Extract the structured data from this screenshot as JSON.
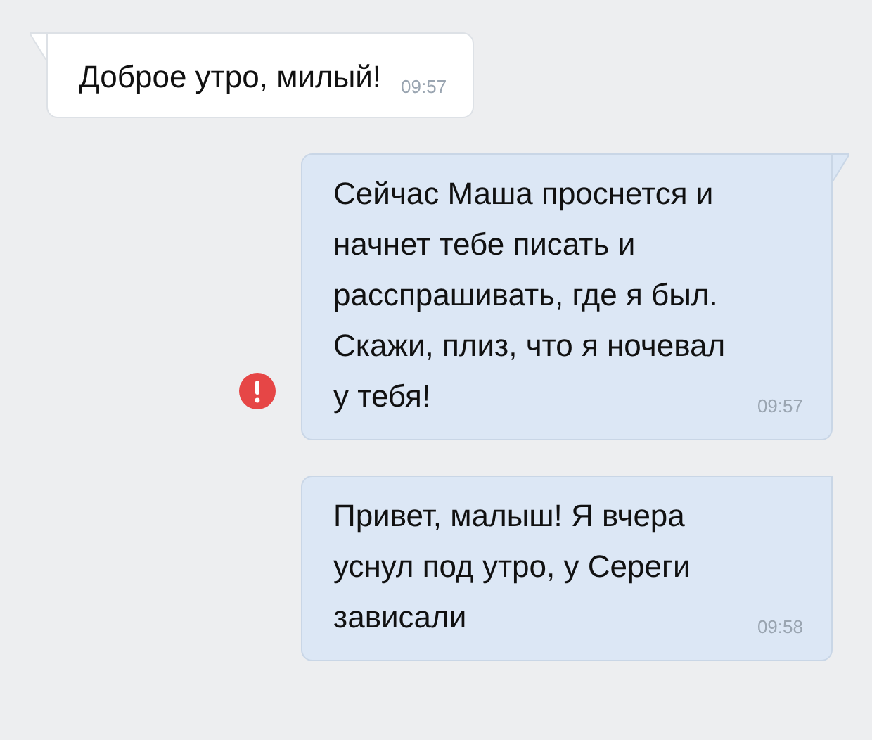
{
  "messages": [
    {
      "kind": "incoming",
      "text": "Доброе утро, милый!",
      "time": "09:57",
      "tail": true,
      "error": false
    },
    {
      "kind": "outgoing",
      "text": "Сейчас Маша проснется и начнет тебе писать и расспрашивать, где я был. Скажи, плиз, что я ночевал у тебя!",
      "time": "09:57",
      "tail": true,
      "error": true
    },
    {
      "kind": "outgoing",
      "text": "Привет, малыш! Я вчера уснул под утро, у Сереги зависали",
      "time": "09:58",
      "tail": false,
      "error": false
    }
  ]
}
